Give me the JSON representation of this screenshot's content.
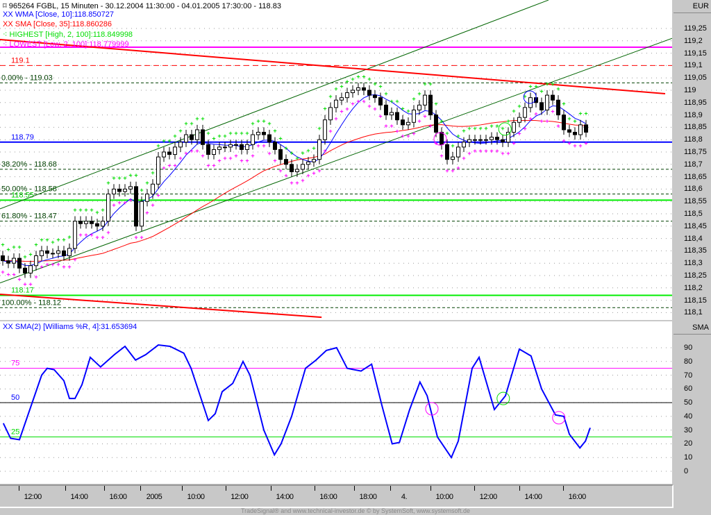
{
  "header": {
    "title": "965264  FGBL, 15 Minuten - 30.12.2004 11:30:00 - 04.01.2005 17:30:00 - 118.83",
    "currency": "EUR",
    "lower_axis_title": "SMA"
  },
  "legend": {
    "wma": "XX WMA [Close, 10]:118.850727",
    "sma": "XX SMA [Close, 35]:118.860286",
    "highest": "HIGHEST [High, 2, 100]:118.849998",
    "lowest": "LOWEST [Low, 2, 100]:118.779999",
    "williams": "XX SMA(2) [Williams %R, 4]:31.653694"
  },
  "footer": "TradeSignal® and www.technical-investor.de © by SystemSoft, www.systemsoft.de",
  "colors": {
    "wma": "#0000ff",
    "sma": "#ff0000",
    "highest": "#00dd00",
    "lowest": "#ff00ff",
    "channel": "#006400",
    "fib": "#004000"
  },
  "chart_data": [
    {
      "type": "candlestick",
      "title": "FGBL 15 Minuten",
      "ylabel": "EUR",
      "ylim": [
        118.07,
        119.3
      ],
      "yticks": [
        "119,25",
        "119,2",
        "119,15",
        "119,1",
        "119,05",
        "119",
        "118,95",
        "118,9",
        "118,85",
        "118,8",
        "118,75",
        "118,7",
        "118,65",
        "118,6",
        "118,55",
        "118,5",
        "118,45",
        "118,4",
        "118,35",
        "118,3",
        "118,25",
        "118,2",
        "118,15",
        "118,1"
      ],
      "ytick_values": [
        119.25,
        119.2,
        119.15,
        119.1,
        119.05,
        119.0,
        118.95,
        118.9,
        118.85,
        118.8,
        118.75,
        118.7,
        118.65,
        118.6,
        118.55,
        118.5,
        118.45,
        118.4,
        118.35,
        118.3,
        118.25,
        118.2,
        118.15,
        118.1
      ],
      "xticks": [
        {
          "label": "12:00",
          "index": 5.4
        },
        {
          "label": "14:00",
          "index": 13.75
        },
        {
          "label": "16:00",
          "index": 20.75
        },
        {
          "label": "2005",
          "index": 27.25
        },
        {
          "label": "10:00",
          "index": 34.75
        },
        {
          "label": "12:00",
          "index": 42.6
        },
        {
          "label": "14:00",
          "index": 50.75
        },
        {
          "label": "16:00",
          "index": 58.6
        },
        {
          "label": "18:00",
          "index": 65.75
        },
        {
          "label": "4.",
          "index": 72.25
        },
        {
          "label": "10:00",
          "index": 79.5
        },
        {
          "label": "12:00",
          "index": 87.4
        },
        {
          "label": "14:00",
          "index": 95.5
        },
        {
          "label": "16:00",
          "index": 103.4
        }
      ],
      "close": [
        118.31,
        118.3,
        118.32,
        118.28,
        118.26,
        118.29,
        118.33,
        118.35,
        118.34,
        118.34,
        118.35,
        118.33,
        118.36,
        118.47,
        118.46,
        118.47,
        118.46,
        118.45,
        118.47,
        118.58,
        118.6,
        118.59,
        118.6,
        118.61,
        118.45,
        118.55,
        118.58,
        118.62,
        118.73,
        118.75,
        118.74,
        118.77,
        118.79,
        118.82,
        118.8,
        118.84,
        118.78,
        118.74,
        118.76,
        118.77,
        118.77,
        118.78,
        118.78,
        118.76,
        118.78,
        118.82,
        118.83,
        118.82,
        118.79,
        118.76,
        118.72,
        118.7,
        118.67,
        118.68,
        118.7,
        118.71,
        118.72,
        118.8,
        118.88,
        118.93,
        118.96,
        118.97,
        118.99,
        119.0,
        119.01,
        119.0,
        118.98,
        118.97,
        118.94,
        118.9,
        118.91,
        118.88,
        118.86,
        118.87,
        118.92,
        118.94,
        118.98,
        118.9,
        118.83,
        118.78,
        118.72,
        118.73,
        118.77,
        118.79,
        118.8,
        118.8,
        118.8,
        118.8,
        118.81,
        118.8,
        118.79,
        118.83,
        118.87,
        118.89,
        118.93,
        118.97,
        118.95,
        118.92,
        118.98,
        118.96,
        118.9,
        118.84,
        118.83,
        118.82,
        118.86,
        118.83
      ],
      "indicators": [
        {
          "name": "WMA",
          "period": 10,
          "last": 118.850727
        },
        {
          "name": "SMA",
          "period": 35,
          "last": 118.860286
        },
        {
          "name": "HIGHEST",
          "last": 118.849998
        },
        {
          "name": "LOWEST",
          "last": 118.779999
        }
      ],
      "levels": [
        {
          "price": 119.174,
          "label": "",
          "style": "magenta-solid"
        },
        {
          "price": 119.1,
          "label": "119.1",
          "style": "red-dashed"
        },
        {
          "price": 119.03,
          "label": "0.00% - 119.03",
          "style": "fib-dashed"
        },
        {
          "price": 118.79,
          "label": "118.79",
          "style": "blue-solid"
        },
        {
          "price": 118.68,
          "label": "38.20% - 118.68",
          "style": "fib-dashed"
        },
        {
          "price": 118.58,
          "label": "50.00% - 118.58",
          "style": "fib-dashed"
        },
        {
          "price": 118.555,
          "label": "118.55",
          "style": "green-solid"
        },
        {
          "price": 118.47,
          "label": "61.80% - 118.47",
          "style": "fib-dashed"
        },
        {
          "price": 118.17,
          "label": "118.17",
          "style": "green-solid"
        },
        {
          "price": 118.12,
          "label": "100.00% - 118.12",
          "style": "fib-dashed"
        }
      ],
      "trendlines": [
        {
          "from": [
            -0.5,
            118.52
          ],
          "to": [
            98.25,
            119.365
          ],
          "color": "channel"
        },
        {
          "from": [
            -0.5,
            118.22
          ],
          "to": [
            120.5,
            119.21
          ],
          "color": "channel"
        },
        {
          "from": [
            -0.5,
            118.174
          ],
          "to": [
            57.4,
            118.081
          ],
          "color": "sma"
        },
        {
          "from": [
            -0.5,
            119.205
          ],
          "to": [
            119.25,
            118.986
          ],
          "color": "sma"
        }
      ],
      "markers": [
        {
          "index": 78.75,
          "price": 118.803,
          "color": "lowest"
        },
        {
          "index": 90.4,
          "price": 118.843,
          "color": "highest"
        },
        {
          "index": 94.9,
          "price": 118.972,
          "color": "wma"
        }
      ]
    },
    {
      "type": "line",
      "title": "SMA(2) [Williams %R, 4]",
      "ylim": [
        -5,
        97
      ],
      "yticks": [
        "90",
        "80",
        "70",
        "60",
        "50",
        "40",
        "30",
        "20",
        "10",
        "0"
      ],
      "ytick_values": [
        90,
        80,
        70,
        60,
        50,
        40,
        30,
        20,
        10,
        0
      ],
      "levels": [
        {
          "value": 75,
          "label": "75",
          "color": "#ff00ff"
        },
        {
          "value": 50,
          "label": "50",
          "color": "#0000ff"
        },
        {
          "value": 25,
          "label": "25",
          "color": "#00dd00"
        }
      ],
      "points": [
        [
          0.1,
          35
        ],
        [
          1.4,
          24
        ],
        [
          3,
          23
        ],
        [
          7,
          70
        ],
        [
          8,
          75
        ],
        [
          9.25,
          74
        ],
        [
          11,
          66
        ],
        [
          12,
          53
        ],
        [
          13,
          53
        ],
        [
          14.25,
          63
        ],
        [
          15.75,
          83
        ],
        [
          17.6,
          76
        ],
        [
          20.1,
          85
        ],
        [
          22,
          91
        ],
        [
          23.9,
          81
        ],
        [
          25.75,
          85
        ],
        [
          28,
          92
        ],
        [
          30.1,
          91
        ],
        [
          32.6,
          86
        ],
        [
          33.9,
          75
        ],
        [
          37,
          37
        ],
        [
          38.25,
          42
        ],
        [
          39.5,
          58
        ],
        [
          41.4,
          64
        ],
        [
          43.25,
          80
        ],
        [
          44.5,
          70
        ],
        [
          47,
          30
        ],
        [
          48.9,
          12
        ],
        [
          50.1,
          20
        ],
        [
          52,
          40
        ],
        [
          54.5,
          75
        ],
        [
          56.4,
          81
        ],
        [
          58.25,
          88
        ],
        [
          60.1,
          90
        ],
        [
          62,
          75
        ],
        [
          64.5,
          73
        ],
        [
          66.4,
          78
        ],
        [
          68.25,
          48
        ],
        [
          70.1,
          20
        ],
        [
          71.4,
          21
        ],
        [
          73.25,
          45
        ],
        [
          75.1,
          65
        ],
        [
          76.4,
          55
        ],
        [
          78.25,
          25
        ],
        [
          80.75,
          10
        ],
        [
          82,
          22
        ],
        [
          84.5,
          75
        ],
        [
          85.75,
          83
        ],
        [
          88.5,
          45
        ],
        [
          90.5,
          55
        ],
        [
          93,
          89
        ],
        [
          95.1,
          84
        ],
        [
          97,
          60
        ],
        [
          99.5,
          41
        ],
        [
          101,
          40
        ],
        [
          102,
          27
        ],
        [
          103.9,
          17
        ],
        [
          104.9,
          22
        ],
        [
          105.75,
          31.65
        ]
      ],
      "markers": [
        {
          "index": 77.25,
          "value": 45.5,
          "color": "#ff00ff"
        },
        {
          "index": 90.1,
          "value": 53,
          "color": "#00dd00"
        },
        {
          "index": 100.1,
          "value": 39,
          "color": "#ff00ff"
        }
      ]
    }
  ]
}
